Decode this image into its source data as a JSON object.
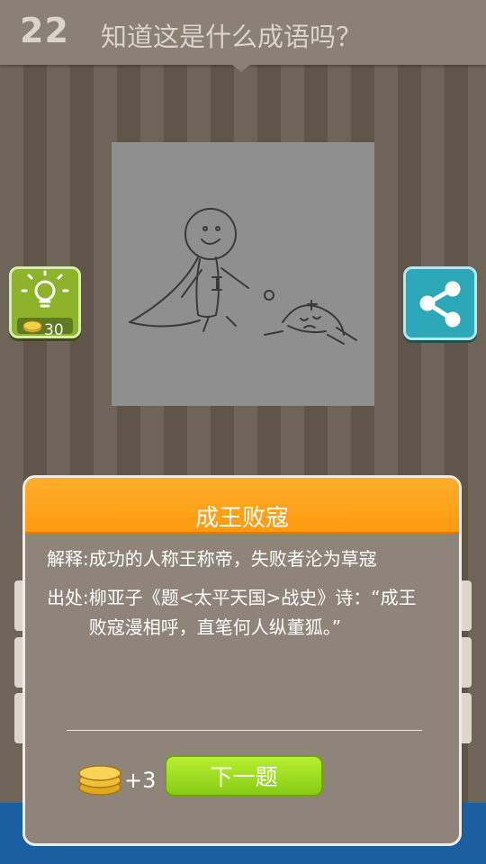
{
  "header": {
    "level": "22",
    "question": "知道这是什么成语吗？"
  },
  "hint": {
    "cost": "30",
    "icon": "lightbulb-icon",
    "coin_icon": "coin-icon"
  },
  "share": {
    "icon": "share-icon"
  },
  "dialog": {
    "title": "成王败寇",
    "explanation_label": "解释:",
    "explanation": "成功的人称王称帝，失败者沦为草寇",
    "source_label": "出处:",
    "source": "柳亚子《题<太平天国>战史》诗：“成王败寇漫相呼，直笔何人纵董狐。”",
    "reward": "+3",
    "next_label": "下一题"
  },
  "colors": {
    "accent_orange": "#ff9a0f",
    "next_green": "#86cc11",
    "hint_green": "#8cb329",
    "share_teal": "#2da8b8"
  }
}
